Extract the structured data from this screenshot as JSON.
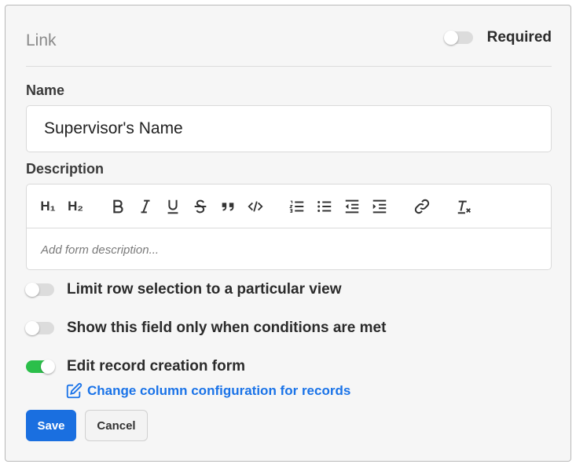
{
  "header": {
    "field_type": "Link",
    "required_label": "Required",
    "required_on": false
  },
  "name": {
    "label": "Name",
    "value": "Supervisor's Name"
  },
  "description": {
    "label": "Description",
    "placeholder": "Add form description...",
    "toolbar": [
      {
        "id": "h1",
        "label": "H₁",
        "icon": "heading-1-icon"
      },
      {
        "id": "h2",
        "label": "H₂",
        "icon": "heading-2-icon"
      },
      {
        "id": "bold",
        "icon": "bold-icon"
      },
      {
        "id": "italic",
        "icon": "italic-icon"
      },
      {
        "id": "underline",
        "icon": "underline-icon"
      },
      {
        "id": "strike",
        "icon": "strikethrough-icon"
      },
      {
        "id": "quote",
        "icon": "quote-icon"
      },
      {
        "id": "code",
        "icon": "code-icon"
      },
      {
        "id": "ol",
        "icon": "ordered-list-icon"
      },
      {
        "id": "ul",
        "icon": "bullet-list-icon"
      },
      {
        "id": "outdent",
        "icon": "outdent-icon"
      },
      {
        "id": "indent",
        "icon": "indent-icon"
      },
      {
        "id": "link",
        "icon": "link-icon"
      },
      {
        "id": "clear",
        "icon": "clear-format-icon"
      }
    ]
  },
  "options": [
    {
      "label": "Limit row selection to a particular view",
      "on": false
    },
    {
      "label": "Show this field only when conditions are met",
      "on": false
    },
    {
      "label": "Edit record creation form",
      "on": true
    }
  ],
  "change_link": "Change column configuration for records",
  "buttons": {
    "save": "Save",
    "cancel": "Cancel"
  },
  "colors": {
    "accent": "#1a6fe0",
    "toggle_on": "#2bbf4a",
    "link": "#1a73e8"
  }
}
